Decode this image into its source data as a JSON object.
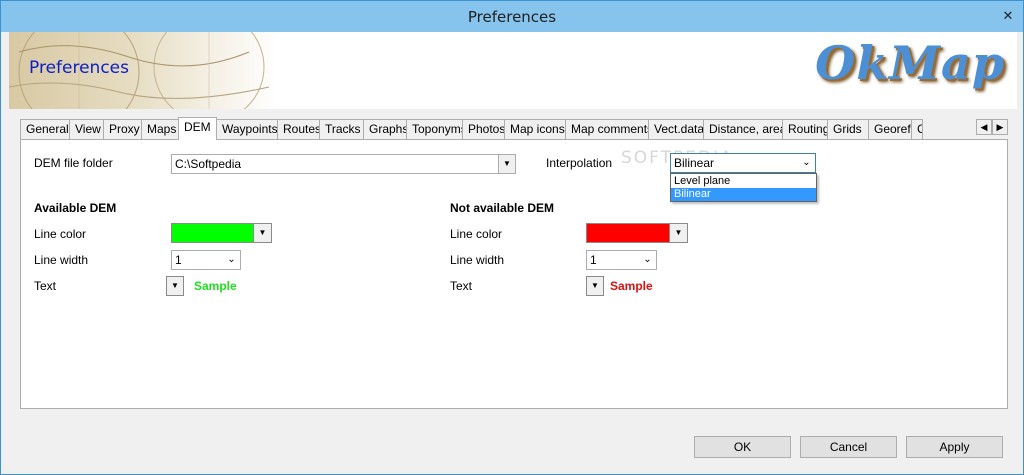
{
  "window": {
    "title": "Preferences",
    "close_glyph": "✕"
  },
  "banner": {
    "title": "Preferences",
    "logo_text": "OkMap"
  },
  "tabs": [
    "General",
    "View",
    "Proxy",
    "Maps",
    "DEM",
    "Waypoints",
    "Routes",
    "Tracks",
    "Graphs",
    "Toponyms",
    "Photos",
    "Map icons",
    "Map comments",
    "Vect.data",
    "Distance, area",
    "Routing",
    "Grids",
    "Georef.",
    "C"
  ],
  "active_tab": "DEM",
  "dem": {
    "folder_label": "DEM file folder",
    "folder_value": "C:\\Softpedia",
    "interpolation_label": "Interpolation",
    "interpolation_value": "Bilinear",
    "interpolation_options": [
      "Level plane",
      "Bilinear"
    ],
    "interpolation_selected": "Bilinear"
  },
  "available": {
    "heading": "Available DEM",
    "line_color_label": "Line color",
    "line_color": "#00ff00",
    "line_width_label": "Line width",
    "line_width_value": "1",
    "text_label": "Text",
    "sample_text": "Sample",
    "sample_color": "#22dd22"
  },
  "not_available": {
    "heading": "Not available DEM",
    "line_color_label": "Line color",
    "line_color": "#ff0000",
    "line_width_label": "Line width",
    "line_width_value": "1",
    "text_label": "Text",
    "sample_text": "Sample",
    "sample_color": "#dd1111"
  },
  "watermark": "SOFTPEDIA",
  "buttons": {
    "ok": "OK",
    "cancel": "Cancel",
    "apply": "Apply"
  }
}
